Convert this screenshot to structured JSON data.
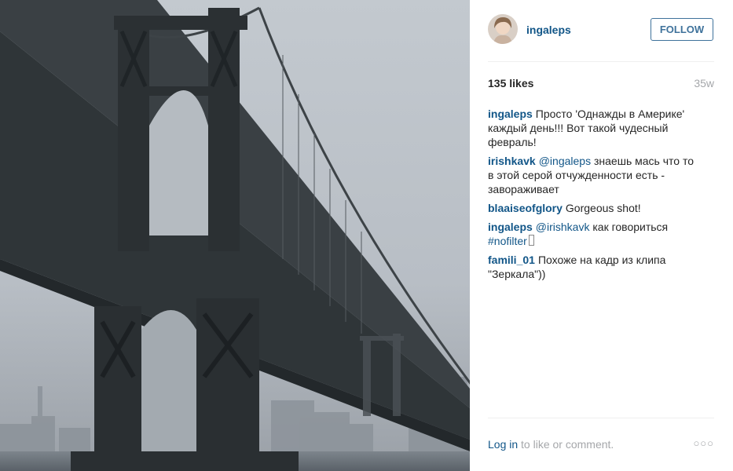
{
  "post": {
    "username": "ingaleps",
    "follow_label": "FOLLOW",
    "likes": "135 likes",
    "age": "35w"
  },
  "comments": [
    {
      "user": "ingaleps",
      "parts": [
        {
          "t": "text",
          "v": "Просто 'Однажды в Америке' каждый день!!! Вот такой чудесный февраль!"
        }
      ]
    },
    {
      "user": "irishkavk",
      "parts": [
        {
          "t": "mention",
          "v": "@ingaleps"
        },
        {
          "t": "text",
          "v": " знаешь мась что то в этой серой отчужденности есть - завораживает"
        }
      ]
    },
    {
      "user": "blaaiseofglory",
      "parts": [
        {
          "t": "text",
          "v": "Gorgeous shot!"
        }
      ]
    },
    {
      "user": "ingaleps",
      "parts": [
        {
          "t": "mention",
          "v": "@irishkavk"
        },
        {
          "t": "text",
          "v": " как говориться "
        },
        {
          "t": "tag",
          "v": "#nofilter"
        },
        {
          "t": "box",
          "v": ""
        }
      ]
    },
    {
      "user": "famili_01",
      "parts": [
        {
          "t": "text",
          "v": "Похоже на кадр из клипа \"Зеркала\"))"
        }
      ]
    }
  ],
  "footer": {
    "login_link": "Log in",
    "login_rest": " to like or comment.",
    "more_label": "○○○"
  },
  "colors": {
    "link": "#125688",
    "follow": "#3f729b",
    "muted": "#a5a7aa"
  },
  "icons": {
    "photo": "bridge-photo",
    "avatar": "user-avatar",
    "more": "more-options-icon"
  }
}
